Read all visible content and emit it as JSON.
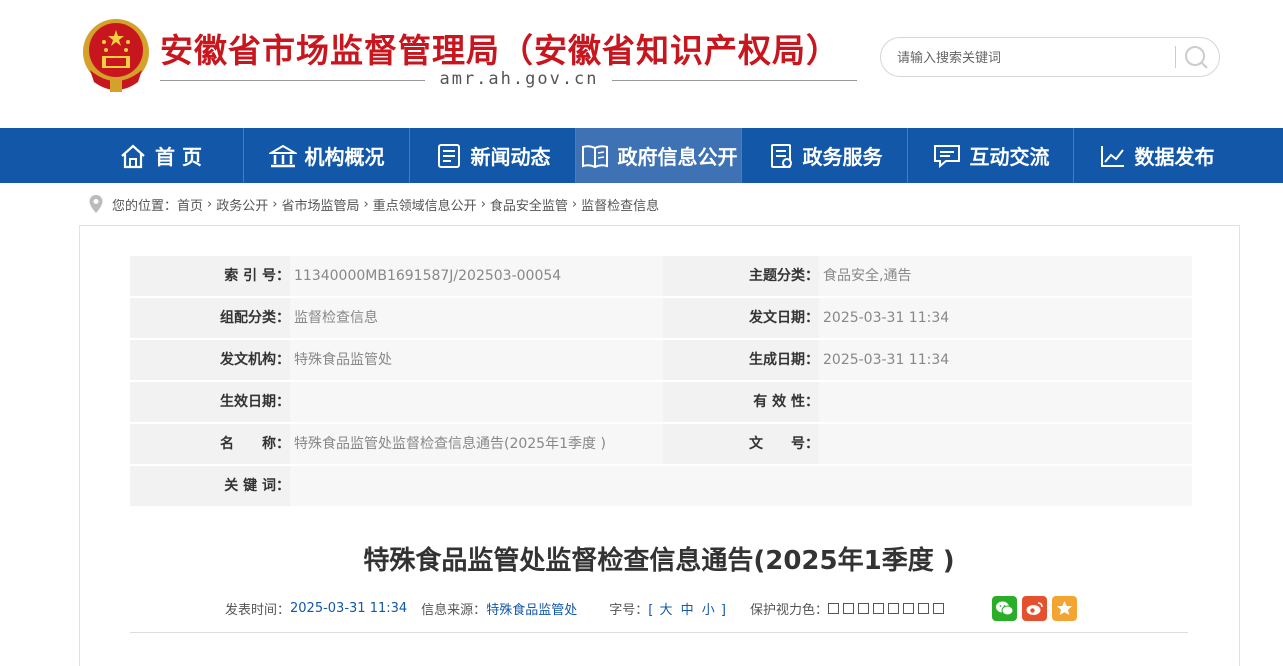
{
  "header": {
    "site_title": "安徽省市场监督管理局（安徽省知识产权局）",
    "domain": "amr.ah.gov.cn",
    "search_placeholder": "请输入搜索关键词"
  },
  "nav": {
    "items": [
      {
        "label": "首 页",
        "icon": "home-icon"
      },
      {
        "label": "机构概况",
        "icon": "institution-icon"
      },
      {
        "label": "新闻动态",
        "icon": "news-icon"
      },
      {
        "label": "政府信息公开",
        "icon": "book-icon",
        "active": true
      },
      {
        "label": "政务服务",
        "icon": "service-icon"
      },
      {
        "label": "互动交流",
        "icon": "chat-icon"
      },
      {
        "label": "数据发布",
        "icon": "chart-icon"
      }
    ]
  },
  "breadcrumb": {
    "prefix": "您的位置：",
    "items": [
      "首页",
      "政务公开",
      "省市场监管局",
      "重点领域信息公开",
      "食品安全监管",
      "监督检查信息"
    ]
  },
  "meta": {
    "rows": [
      {
        "l1": "索 引 号：",
        "v1": "11340000MB1691587J/202503-00054",
        "l2": "主题分类：",
        "v2": "食品安全,通告"
      },
      {
        "l1": "组配分类：",
        "v1": "监督检查信息",
        "l2": "发文日期：",
        "v2": "2025-03-31 11:34"
      },
      {
        "l1": "发文机构：",
        "v1": "特殊食品监管处",
        "l2": "生成日期：",
        "v2": "2025-03-31 11:34"
      },
      {
        "l1": "生效日期：",
        "v1": "",
        "l2": "有 效 性：",
        "v2": ""
      },
      {
        "l1": "名　　称：",
        "v1": "特殊食品监管处监督检查信息通告(2025年1季度 )",
        "l2": "文　　号：",
        "v2": ""
      }
    ],
    "keywords_label": "关 键 词：",
    "keywords_value": ""
  },
  "article": {
    "title": "特殊食品监管处监督检查信息通告(2025年1季度 )",
    "publish_label": "发表时间：",
    "publish_time": "2025-03-31 11:34",
    "source_label": "信息来源：",
    "source": "特殊食品监管处",
    "font_label": "字号：",
    "font_open": "[",
    "font_large": "大",
    "font_medium": "中",
    "font_small": "小",
    "font_close": "]",
    "eye_label": "保护视力色："
  },
  "colors": {
    "brand_red": "#c8161e",
    "nav_blue": "#1357a8",
    "wechat": "#2aae29",
    "weibo": "#e6512d",
    "favorite": "#f4a531"
  }
}
